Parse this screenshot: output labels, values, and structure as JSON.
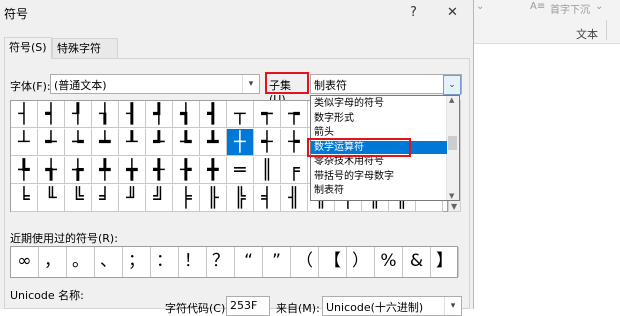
{
  "dialog": {
    "title": "符号",
    "help_glyph": "?",
    "close_glyph": "✕",
    "tabs": [
      {
        "label": "符号(S)"
      },
      {
        "label": "特殊字符(P)"
      }
    ],
    "font_label": "字体(F):",
    "font_value": "(普通文本)",
    "subset_label": "子集(U)",
    "subset_value": "制表符",
    "symbols": [
      [
        "┤",
        "┥",
        "┦",
        "┧",
        "┨",
        "┩",
        "┪",
        "┫",
        "┬",
        "┭",
        "┮",
        "┯",
        "┰",
        "┱",
        "┲",
        "┳"
      ],
      [
        "┴",
        "┵",
        "┶",
        "┷",
        "┸",
        "┹",
        "┺",
        "┻",
        "┼",
        "┽",
        "┾",
        "┿",
        "╀",
        "╁",
        "╂",
        "╃"
      ],
      [
        "╄",
        "╅",
        "╆",
        "╇",
        "╈",
        "╉",
        "╊",
        "╋",
        "═",
        "║",
        "╒",
        "╓",
        "╔",
        "╕",
        "╖",
        "╗"
      ],
      [
        "╘",
        "╙",
        "╚",
        "╛",
        "╜",
        "╝",
        "╞",
        "╟",
        "╠",
        "╡",
        "╢",
        "╣",
        "╤",
        "╥",
        "╦",
        "╧"
      ]
    ],
    "subset_list": [
      {
        "label": "类似字母的符号"
      },
      {
        "label": "数字形式"
      },
      {
        "label": "箭头"
      },
      {
        "label": "数学运算符"
      },
      {
        "label": "零杂技术用符号"
      },
      {
        "label": "带括号的字母数字"
      },
      {
        "label": "制表符"
      }
    ],
    "recent_label": "近期使用过的符号(R):",
    "recent_symbols": [
      "∞",
      "，",
      "。",
      "、",
      "；",
      "：",
      "！",
      "？",
      "“",
      "”",
      "（",
      "【",
      "）",
      "%",
      "&",
      "】"
    ],
    "unicode_name_label": "Unicode 名称:",
    "char_code_label": "字符代码(C):",
    "char_code_value": "253F",
    "from_label": "来自(M):",
    "from_value": "Unicode(十六进制)"
  },
  "background_app": {
    "ribbon_partial_label": "首字下沉",
    "ribbon_group_label": "文本"
  },
  "colors": {
    "highlight": "#0078d7",
    "annotation_red": "#e0141a",
    "dialog_bg": "#f0f0f0"
  },
  "selection": {
    "symbol_row": 1,
    "symbol_col": 8,
    "subset_index": 3
  }
}
